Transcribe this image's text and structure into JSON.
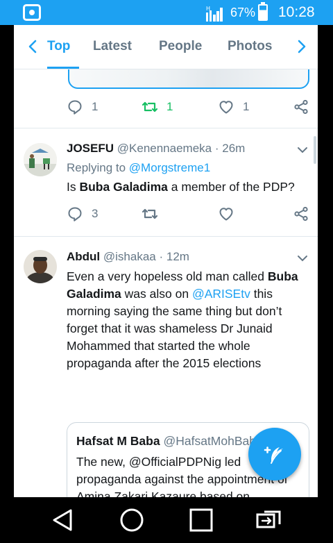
{
  "status_bar": {
    "battery_percent": "67%",
    "battery_level": 0.67,
    "network_type": "H",
    "time": "10:28"
  },
  "tabs": {
    "items": [
      {
        "label": "Top",
        "active": true
      },
      {
        "label": "Latest",
        "active": false
      },
      {
        "label": "People",
        "active": false
      },
      {
        "label": "Photos",
        "active": false
      }
    ]
  },
  "previous_tweet": {
    "reply_count": "1",
    "retweet_count": "1",
    "like_count": "1",
    "retweeted": true
  },
  "tweets": [
    {
      "name": "JOSEFU",
      "handle": "@Kenennaemeka",
      "time": "· 26m",
      "replying_prefix": "Replying to",
      "replying_to": "@Morgstreme1",
      "text_1": "Is ",
      "text_bold": "Buba Galadima",
      "text_2": " a member of the PDP?",
      "reply_count": "3"
    },
    {
      "name": "Abdul",
      "handle": "@ishakaa",
      "time": "· 12m",
      "text_1": "Even a very hopeless old man called",
      "text_bold": "Buba Galadima",
      "text_2": " was also on ",
      "text_link": "@ARISEtv",
      "text_3": " this morning saying the same thing but don’t forget that it was shameless Dr Junaid Mohammed that started the whole propaganda after the 2015 elections",
      "quote": {
        "name": "Hafsat M Baba",
        "handle": "@HafsatMohBaba",
        "text": "The new, @OfficialPDPNig led propaganda against the appointment of Amina Zakari Kazaure based on unfounded stories of kinship with"
      }
    }
  ],
  "colors": {
    "accent": "#1da1f2",
    "retweet_green": "#17bf63",
    "secondary_text": "#657786"
  }
}
